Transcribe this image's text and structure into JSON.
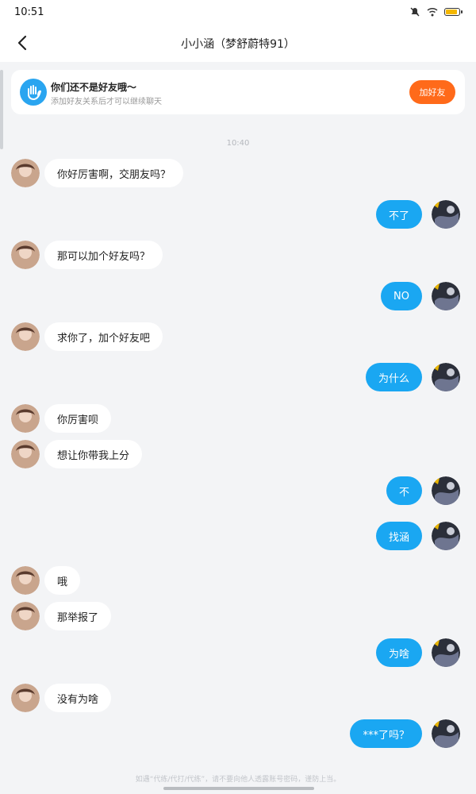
{
  "status_bar": {
    "time": "10:51"
  },
  "header": {
    "title": "小小涵（梦舒蔚特91）"
  },
  "banner": {
    "title": "你们还不是好友哦～",
    "subtitle": "添加好友关系后才可以继续聊天",
    "add_button": "加好友"
  },
  "timestamp": "10:40",
  "messages": [
    {
      "side": "left",
      "text": "你好厉害啊，交朋友吗？"
    },
    {
      "side": "right",
      "text": "不了"
    },
    {
      "side": "left",
      "text": "那可以加个好友吗？"
    },
    {
      "side": "right",
      "text": "NO"
    },
    {
      "side": "left",
      "text": "求你了，加个好友吧"
    },
    {
      "side": "right",
      "text": "为什么"
    },
    {
      "side": "left",
      "text": "你厉害呗"
    },
    {
      "side": "left",
      "text": "想让你带我上分"
    },
    {
      "side": "right",
      "text": "不"
    },
    {
      "side": "right",
      "text": "找涵"
    },
    {
      "side": "left",
      "text": "哦"
    },
    {
      "side": "left",
      "text": "那举报了"
    },
    {
      "side": "right",
      "text": "为啥"
    },
    {
      "side": "left",
      "text": "没有为啥"
    },
    {
      "side": "right",
      "text": "***了吗？"
    }
  ],
  "footer": {
    "notice": "如遇“代练/代打/代练”，请不要向他人透露账号密码，谨防上当。"
  },
  "colors": {
    "accent": "#1aa7f2",
    "add_button": "#ff6a1a",
    "background": "#f3f4f6"
  }
}
